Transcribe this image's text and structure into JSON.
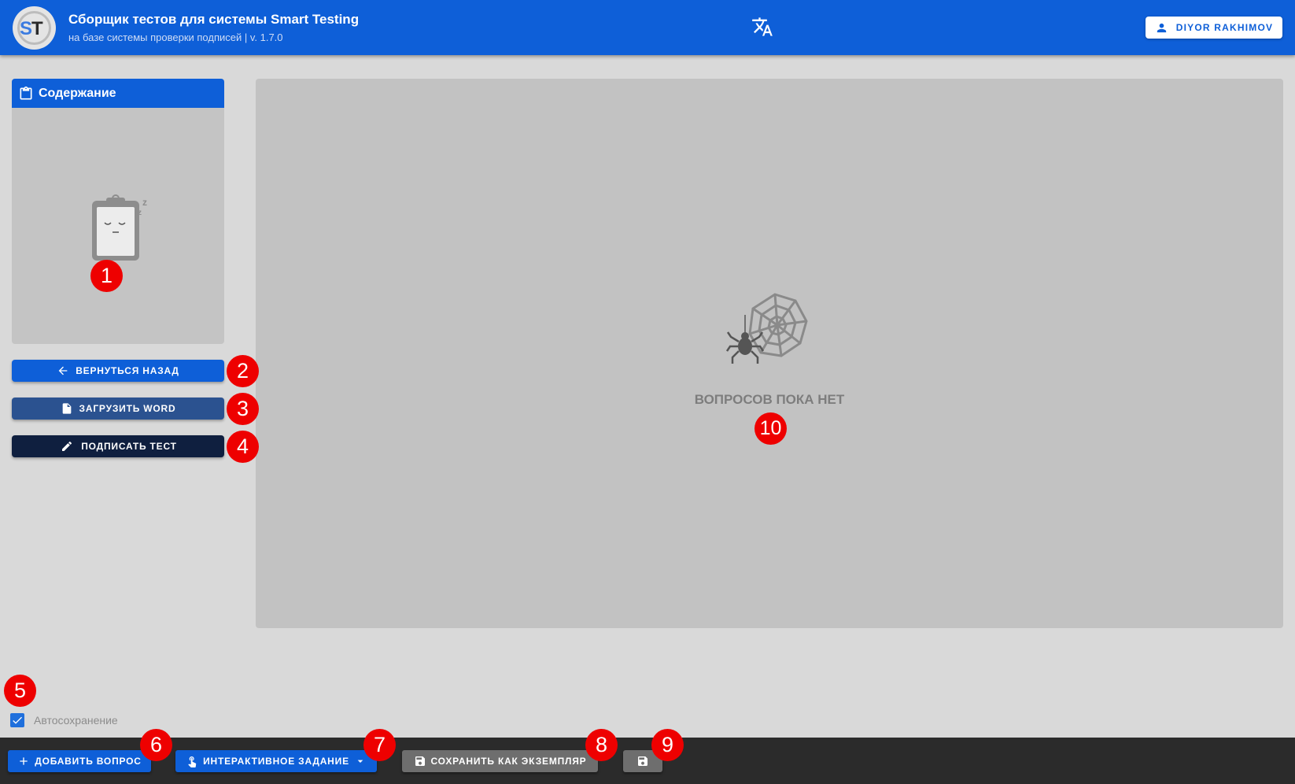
{
  "header": {
    "title": "Сборщик тестов для системы Smart Testing",
    "subtitle": "на базе системы проверки подписей | v. 1.7.0",
    "user_name": "DIYOR RAKHIMOV",
    "colors": {
      "primary": "#0e5fd8"
    }
  },
  "sidebar": {
    "content_title": "Содержание",
    "back_label": "ВЕРНУТЬСЯ НАЗАД",
    "upload_word_label": "ЗАГРУЗИТЬ WORD",
    "sign_test_label": "ПОДПИСАТЬ ТЕСТ"
  },
  "main": {
    "empty_text": "ВОПРОСОВ ПОКА НЕТ"
  },
  "autosave": {
    "label": "Автосохранение",
    "checked": true
  },
  "footer": {
    "add_question_label": "ДОБАВИТЬ ВОПРОС",
    "interactive_task_label": "ИНТЕРАКТИВНОЕ ЗАДАНИЕ",
    "save_as_copy_label": "СОХРАНИТЬ КАК ЭКЗЕМПЛЯР"
  },
  "markers": [
    "1",
    "2",
    "3",
    "4",
    "5",
    "6",
    "7",
    "8",
    "9",
    "10"
  ]
}
